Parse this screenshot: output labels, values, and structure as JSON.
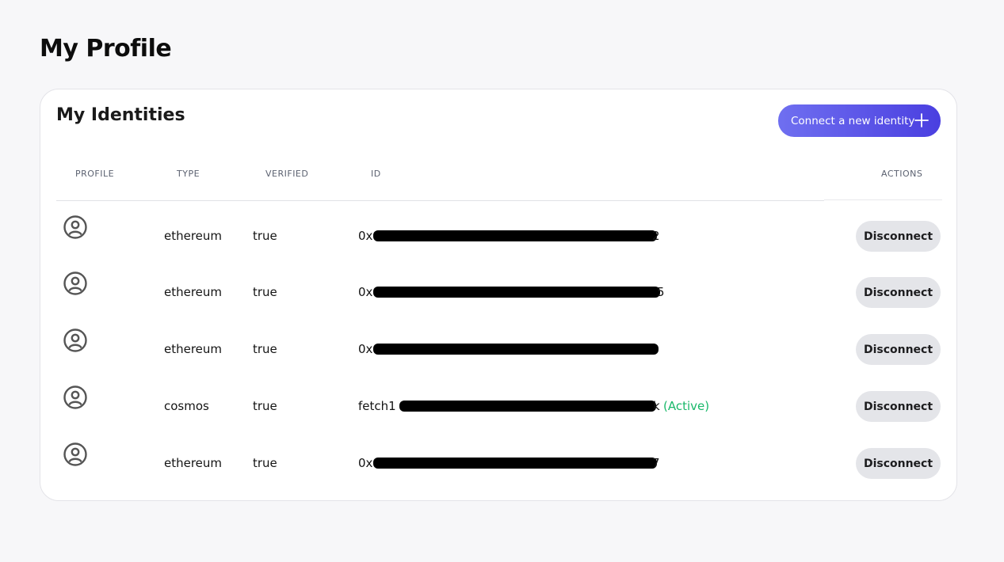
{
  "page": {
    "title": "My Profile"
  },
  "card": {
    "title": "My Identities",
    "connect_button": {
      "label": "Connect a new identity",
      "icon": "plus-icon"
    }
  },
  "table": {
    "headers": [
      "PROFILE",
      "TYPE",
      "VERIFIED",
      "ID",
      "ACTIONS"
    ],
    "rows": [
      {
        "avatar_icon": "user-circle-icon",
        "type": "ethereum",
        "verified": "true",
        "id_prefix": "0x",
        "id_suffix": "2",
        "active": "",
        "action": "Disconnect"
      },
      {
        "avatar_icon": "user-circle-icon",
        "type": "ethereum",
        "verified": "true",
        "id_prefix": "0x",
        "id_suffix": "5",
        "active": "",
        "action": "Disconnect"
      },
      {
        "avatar_icon": "user-circle-icon",
        "type": "ethereum",
        "verified": "true",
        "id_prefix": "0x",
        "id_suffix": "",
        "active": "",
        "action": "Disconnect"
      },
      {
        "avatar_icon": "user-circle-icon",
        "type": "cosmos",
        "verified": "true",
        "id_prefix": "fetch1",
        "id_suffix": "k",
        "active": "(Active)",
        "action": "Disconnect"
      },
      {
        "avatar_icon": "user-circle-icon",
        "type": "ethereum",
        "verified": "true",
        "id_prefix": "0x",
        "id_suffix": "7",
        "active": "",
        "action": "Disconnect"
      }
    ]
  },
  "colors": {
    "accent_gradient_start": "#6f6ff0",
    "accent_gradient_end": "#4a3fe0",
    "active_green": "#19b86a",
    "disconnect_bg": "#e4e5e9"
  }
}
